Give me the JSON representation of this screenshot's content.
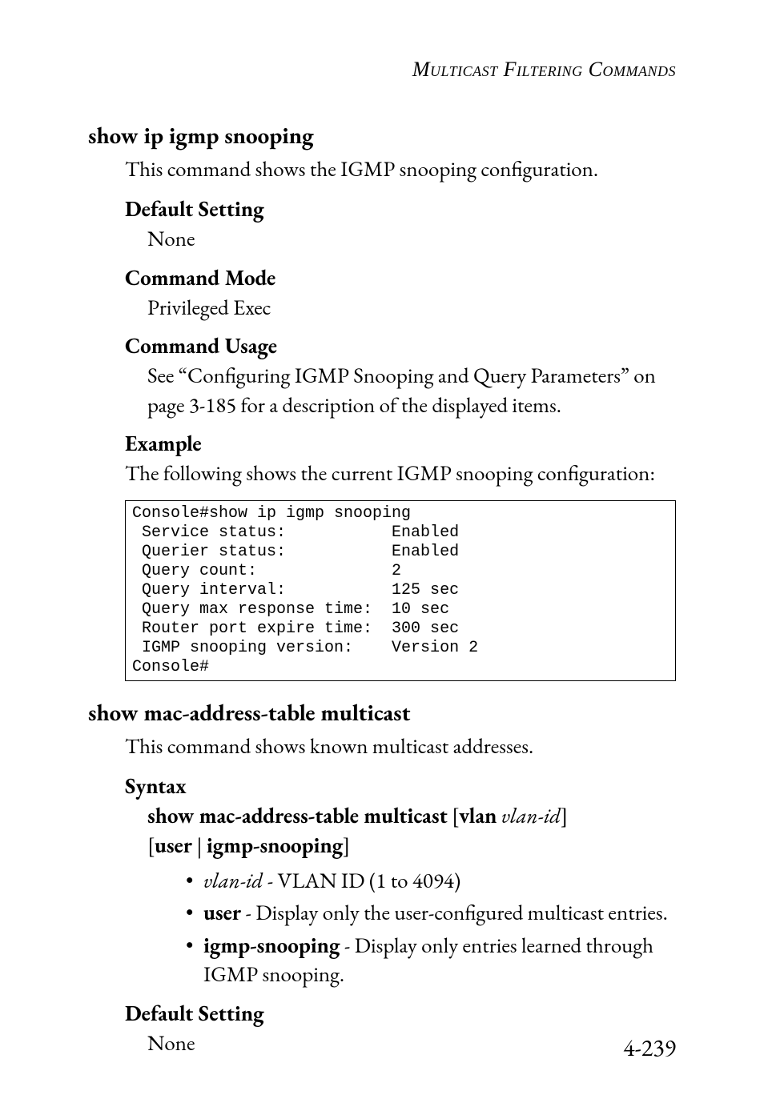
{
  "running_head": "Multicast Filtering Commands",
  "section1": {
    "heading": "show ip igmp snooping",
    "intro": "This command shows the IGMP snooping configuration.",
    "default_heading": "Default Setting",
    "default_value": "None",
    "mode_heading": "Command Mode",
    "mode_value": "Privileged Exec",
    "usage_heading": "Command Usage",
    "usage_value": "See “Configuring IGMP Snooping and Query Parameters” on page 3-185 for a description of the displayed items.",
    "example_heading": "Example",
    "example_intro": "The following shows the current IGMP snooping configuration:",
    "code": "Console#show ip igmp snooping\n Service status:           Enabled\n Querier status:           Enabled\n Query count:              2\n Query interval:           125 sec\n Query max response time:  10 sec\n Router port expire time:  300 sec\n IGMP snooping version:    Version 2\nConsole#"
  },
  "section2": {
    "heading": "show mac-address-table multicast",
    "intro": "This command shows known multicast addresses.",
    "syntax_heading": "Syntax",
    "syntax_l1a": "show mac-address-table multicast",
    "syntax_l1b": " [",
    "syntax_l1c": "vlan",
    "syntax_l1d": " ",
    "syntax_l1e": "vlan-id",
    "syntax_l1f": "]",
    "syntax_l2a": "[",
    "syntax_l2b": "user",
    "syntax_l2c": " | ",
    "syntax_l2d": "igmp-snooping",
    "syntax_l2e": "]",
    "bullets": {
      "b1a": "vlan-id",
      "b1b": " - VLAN ID (1 to 4094)",
      "b2a": "user",
      "b2b": " - Display only the user-configured multicast entries.",
      "b3a": "igmp-snooping",
      "b3b": " - Display only entries learned through IGMP snooping."
    },
    "default_heading": "Default Setting",
    "default_value": "None"
  },
  "page_number": "4-239"
}
